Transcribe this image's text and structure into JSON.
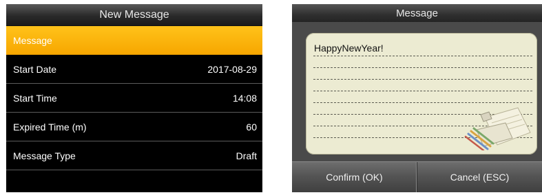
{
  "left_screen": {
    "title": "New Message",
    "rows": [
      {
        "label": "Message",
        "value": ""
      },
      {
        "label": "Start Date",
        "value": "2017-08-29"
      },
      {
        "label": "Start Time",
        "value": "14:08"
      },
      {
        "label": "Expired Time (m)",
        "value": "60"
      },
      {
        "label": "Message Type",
        "value": "Draft"
      }
    ],
    "selected_row": "Message",
    "colors": {
      "highlight": "#f7a700",
      "background": "#000000"
    }
  },
  "right_screen": {
    "title": "Message",
    "message_text": "HappyNewYear!",
    "icon": "notepad-icon",
    "buttons": {
      "confirm": "Confirm (OK)",
      "cancel": "Cancel (ESC)"
    },
    "colors": {
      "panel": "#ecebd2",
      "background": "#4a4a4a"
    }
  }
}
